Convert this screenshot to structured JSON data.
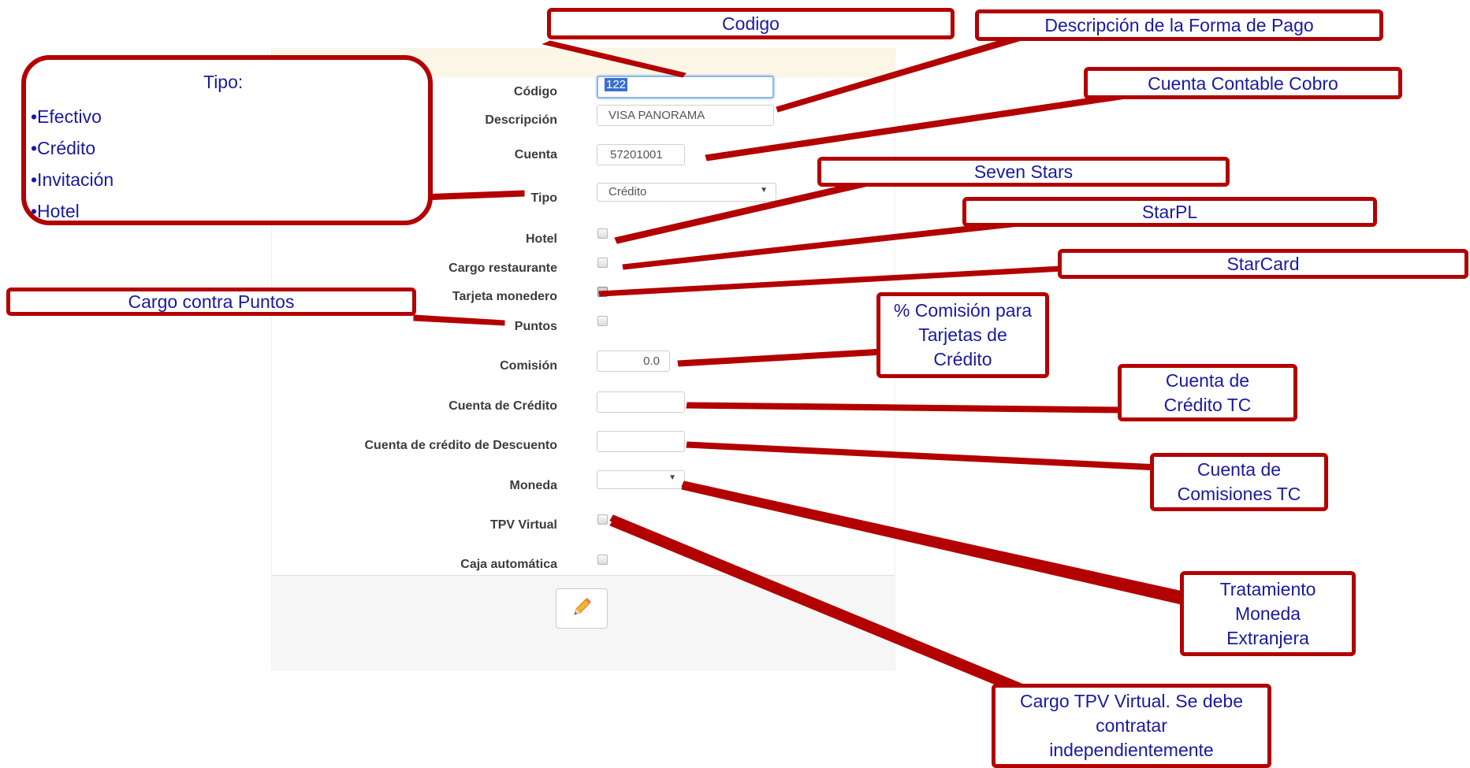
{
  "form": {
    "fields": {
      "codigo": {
        "label": "Código",
        "value": "122"
      },
      "descripcion": {
        "label": "Descripción",
        "value": "VISA PANORAMA"
      },
      "cuenta": {
        "label": "Cuenta",
        "value": "57201001"
      },
      "tipo": {
        "label": "Tipo",
        "value": "Crédito"
      },
      "hotel": {
        "label": "Hotel"
      },
      "cargo_restaurante": {
        "label": "Cargo restaurante"
      },
      "tarjeta_monedero": {
        "label": "Tarjeta monedero"
      },
      "puntos": {
        "label": "Puntos"
      },
      "comision": {
        "label": "Comisión",
        "value": "0.0"
      },
      "cuenta_credito": {
        "label": "Cuenta de Crédito",
        "value": ""
      },
      "cuenta_credito_descuento": {
        "label": "Cuenta de crédito de Descuento",
        "value": ""
      },
      "moneda": {
        "label": "Moneda",
        "value": ""
      },
      "tpv_virtual": {
        "label": "TPV Virtual"
      },
      "caja_automatica": {
        "label": "Caja automática"
      }
    },
    "edit_icon": "pencil-icon"
  },
  "callouts": {
    "codigo": "Codigo",
    "descripcion": "Descripción de la Forma de Pago",
    "cuenta": "Cuenta Contable Cobro",
    "tipo": {
      "title": "Tipo:",
      "items": [
        "•Efectivo",
        "•Crédito",
        "•Invitación",
        "•Hotel"
      ]
    },
    "seven_stars": "Seven Stars",
    "starpl": "StarPL",
    "starcard": "StarCard",
    "puntos": "Cargo contra Puntos",
    "comision": [
      "% Comisión para",
      "Tarjetas de",
      "Crédito"
    ],
    "cuenta_credito": [
      "Cuenta de",
      "Crédito TC"
    ],
    "cuenta_comisiones": [
      "Cuenta de",
      "Comisiones TC"
    ],
    "moneda": [
      "Tratamiento",
      "Moneda",
      "Extranjera"
    ],
    "tpv": [
      "Cargo TPV Virtual. Se debe",
      "contratar",
      "independientemente"
    ]
  },
  "colors": {
    "callout_border": "#b30000",
    "callout_text": "#1a1aa0",
    "focus": "#8ab6e8"
  }
}
